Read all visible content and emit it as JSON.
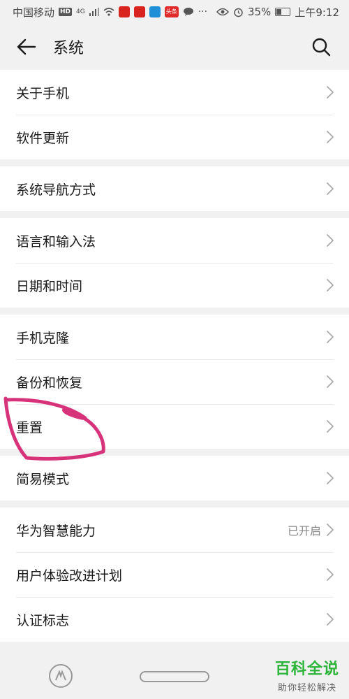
{
  "status_bar": {
    "carrier": "中国移动",
    "hd": "HD",
    "network": "4G",
    "news_app": "头条",
    "dots": "···",
    "battery": "35%",
    "time": "上午9:12"
  },
  "header": {
    "title": "系统"
  },
  "groups": [
    {
      "items": [
        {
          "label": "关于手机"
        },
        {
          "label": "软件更新"
        }
      ]
    },
    {
      "items": [
        {
          "label": "系统导航方式"
        }
      ]
    },
    {
      "items": [
        {
          "label": "语言和输入法"
        },
        {
          "label": "日期和时间"
        }
      ]
    },
    {
      "items": [
        {
          "label": "手机克隆"
        },
        {
          "label": "备份和恢复"
        },
        {
          "label": "重置"
        }
      ]
    },
    {
      "items": [
        {
          "label": "简易模式"
        }
      ]
    },
    {
      "items": [
        {
          "label": "华为智慧能力",
          "value": "已开启"
        },
        {
          "label": "用户体验改进计划"
        },
        {
          "label": "认证标志"
        }
      ]
    }
  ],
  "watermark": {
    "main": "百科全说",
    "sub": "助你轻松解决"
  },
  "colors": {
    "scribble": "#d6337a",
    "watermark": "#2db43a"
  }
}
